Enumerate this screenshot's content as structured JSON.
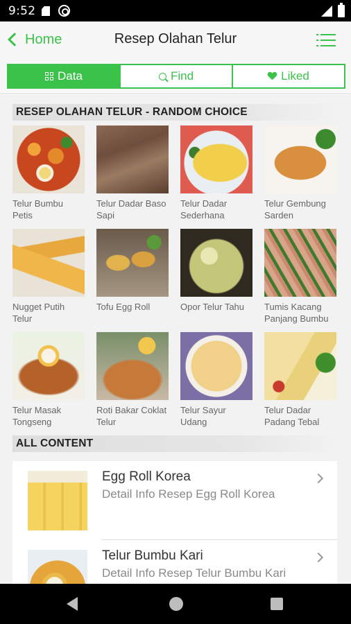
{
  "status_bar": {
    "time": "9:52"
  },
  "app_bar": {
    "back_label": "Home",
    "title": "Resep Olahan Telur"
  },
  "tabs": [
    {
      "label": "Data",
      "icon": "grid-icon",
      "active": true
    },
    {
      "label": "Find",
      "icon": "search-icon",
      "active": false
    },
    {
      "label": "Liked",
      "icon": "heart-icon",
      "active": false
    }
  ],
  "random_section": {
    "title": "RESEP OLAHAN TELUR - RANDOM CHOICE",
    "items": [
      {
        "label": "Telur Bumbu Petis"
      },
      {
        "label": "Telur Dadar Baso Sapi"
      },
      {
        "label": "Telur Dadar Sederhana"
      },
      {
        "label": "Telur Gembung Sarden"
      },
      {
        "label": "Nugget Putih Telur"
      },
      {
        "label": "Tofu Egg Roll"
      },
      {
        "label": "Opor Telur Tahu"
      },
      {
        "label": "Tumis Kacang Panjang Bumbu"
      },
      {
        "label": "Telur Masak Tongseng"
      },
      {
        "label": "Roti Bakar Coklat Telur"
      },
      {
        "label": "Telur Sayur Udang"
      },
      {
        "label": "Telur Dadar Padang Tebal"
      }
    ]
  },
  "all_section": {
    "title": "ALL CONTENT",
    "items": [
      {
        "title": "Egg Roll Korea",
        "subtitle": "Detail Info Resep Egg Roll Korea"
      },
      {
        "title": "Telur Bumbu Kari",
        "subtitle": "Detail Info Resep Telur Bumbu Kari"
      }
    ]
  },
  "colors": {
    "accent": "#3ac24a",
    "background": "#f2f2f2"
  }
}
